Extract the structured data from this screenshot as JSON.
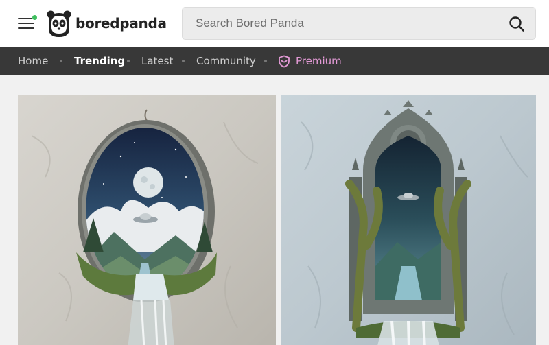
{
  "header": {
    "logo_text": "boredpanda",
    "search_placeholder": "Search Bored Panda"
  },
  "nav": {
    "items": [
      {
        "label": "Home",
        "active": false
      },
      {
        "label": "Trending",
        "active": true
      },
      {
        "label": "Latest",
        "active": false
      },
      {
        "label": "Community",
        "active": false
      }
    ],
    "premium_label": "Premium"
  },
  "colors": {
    "nav_background": "#383838",
    "premium_accent": "#e39ad6",
    "notification_dot": "#3fbf5f"
  },
  "content": {
    "images": [
      {
        "subject": "oval frame wall diorama with moon, clouds, UFO and waterfall"
      },
      {
        "subject": "gothic arch wall diorama with trees, UFO and waterfall"
      }
    ]
  }
}
